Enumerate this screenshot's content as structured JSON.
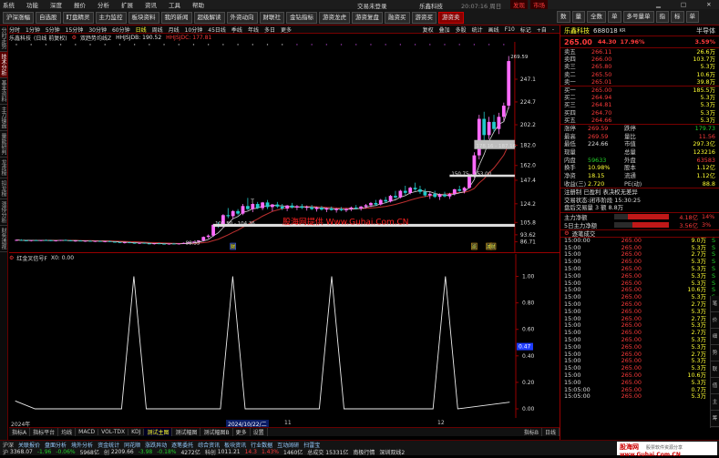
{
  "menu": [
    "系统",
    "功能",
    "深度",
    "报价",
    "分析",
    "扩展",
    "资讯",
    "工具",
    "帮助"
  ],
  "window_title": "交易未登录",
  "app_name": "乐鑫科技",
  "time": "20:07:16 周日",
  "menu_right": [
    {
      "label": "发现",
      "color": "#ff3b3b"
    },
    {
      "label": "市场",
      "color": "#ff3b3b"
    }
  ],
  "toolbar_buttons": [
    "沪深涨幅",
    "自选股",
    "盯盘精灵",
    "主力监控",
    "板块资料",
    "我的新闻",
    "超级解读",
    "外资动向",
    "财联社",
    "金钻指标",
    "游资龙虎",
    "游资复盘",
    "融资买",
    "",
    "",
    "游资买",
    "游资卖"
  ],
  "toolbar_right": [
    "数",
    "量",
    "全数",
    "单",
    "多号量单",
    "指",
    "标",
    "单"
  ],
  "left_tabs": [
    "分时走势",
    "技术分析",
    "基本资料",
    "主力操盘",
    "量能研判",
    "龙虎榜",
    "扣龙榜",
    "涨停分析",
    "财务透视"
  ],
  "period_bar": [
    "分时",
    "1分钟",
    "5分钟",
    "15分钟",
    "30分钟",
    "60分钟",
    "日线",
    "周线",
    "月线",
    "10分钟",
    "45日线",
    "季线",
    "年线",
    "多日",
    "更多"
  ],
  "period_selected": "日线",
  "period_right": [
    "复权",
    "叠加",
    "多股",
    "统计",
    "画线",
    "F10",
    "标记",
    "+自",
    "-"
  ],
  "chart_header": {
    "symbol": "乐鑫科技",
    "mode": "(日线 前复权)",
    "indicator": "双趋势均线Z",
    "ma1": "HHJSJDB: 190.52",
    "ma2": "HHJSJDC: 177.81"
  },
  "y_axis_main": [
    "247.1",
    "224.7",
    "202.2",
    "182.0",
    "162.0",
    "147.4",
    "124.2",
    "105.8",
    "93.62",
    "86.71"
  ],
  "price_annotations": [
    {
      "text": "269.59",
      "color": "#ddd"
    },
    {
      "text": "178.16 - 187.16",
      "color": "#ddd"
    },
    {
      "text": "150.75 - 153.00",
      "color": "#ddd"
    },
    {
      "text": "101.50 - 104.36",
      "color": "#ddd"
    },
    {
      "text": "88.33",
      "color": "#ddd"
    }
  ],
  "watermark": "股海网提供 Www.Guhai.Com.CN",
  "event_markers": [
    "财",
    "派",
    "减",
    "财"
  ],
  "sub_indicator": {
    "name": "红金叉信号F",
    "value": "X0: 0.00"
  },
  "y_axis_sub": [
    "1.00",
    "0.80",
    "0.60",
    "0.40",
    "0.20",
    "0.00"
  ],
  "y_axis_sub_marker": "0.47",
  "date_axis": [
    "2024年",
    "2024/10/22/二",
    "11",
    "12"
  ],
  "bottom_tabs": [
    "指标A",
    "指标平台",
    "均线",
    "MACD",
    "VOL-TDX",
    "KDJ",
    "测试主图",
    "测试幅图",
    "测试幅图B",
    "更多",
    "设置"
  ],
  "bottom_right": [
    "指标B",
    "日线"
  ],
  "stock": {
    "name": "乐鑫科技",
    "code": "688018",
    "tag": "KR",
    "extra": "半导体",
    "price": "265.00",
    "change": "44.30",
    "pct": "17.96%",
    "pct_right": "3.59%"
  },
  "asks": [
    {
      "label": "卖五",
      "price": "266.11",
      "vol": "26.6万"
    },
    {
      "label": "卖四",
      "price": "266.00",
      "vol": "103.7万"
    },
    {
      "label": "卖三",
      "price": "265.80",
      "vol": "5.3万"
    },
    {
      "label": "卖二",
      "price": "265.50",
      "vol": "10.6万"
    },
    {
      "label": "卖一",
      "price": "265.01",
      "vol": "39.8万"
    }
  ],
  "bids": [
    {
      "label": "买一",
      "price": "265.00",
      "vol": "185.5万"
    },
    {
      "label": "买二",
      "price": "264.94",
      "vol": "5.3万"
    },
    {
      "label": "买三",
      "price": "264.81",
      "vol": "5.3万"
    },
    {
      "label": "买四",
      "price": "264.70",
      "vol": "5.3万"
    },
    {
      "label": "买五",
      "price": "264.66",
      "vol": "5.3万"
    }
  ],
  "stats": [
    {
      "k": "涨停",
      "v": "269.59",
      "c": "red",
      "k2": "跌停",
      "v2": "179.73",
      "c2": "grn"
    },
    {
      "k": "最高",
      "v": "269.59",
      "c": "red",
      "k2": "量比",
      "v2": "11.56",
      "c2": "red"
    },
    {
      "k": "最低",
      "v": "224.66",
      "c": "wht",
      "k2": "市值",
      "v2": "297.3亿",
      "c2": "yel"
    },
    {
      "k": "现量",
      "v": "",
      "c": "wht",
      "k2": "总量",
      "v2": "123216",
      "c2": "yel"
    },
    {
      "k": "内盘",
      "v": "59633",
      "c": "grn",
      "k2": "外盘",
      "v2": "63583",
      "c2": "red"
    },
    {
      "k": "换手",
      "v": "10.98%",
      "c": "yel",
      "k2": "股本",
      "v2": "1.12亿",
      "c2": "yel"
    },
    {
      "k": "净资",
      "v": "18.15",
      "c": "yel",
      "k2": "流通",
      "v2": "1.12亿",
      "c2": "yel"
    },
    {
      "k": "收益(三)",
      "v": "2.720",
      "c": "yel",
      "k2": "PE(动)",
      "v2": "88.8",
      "c2": "yel"
    }
  ],
  "info_lines": [
    "注册制 已盈利 表决权无差异",
    "交易状态:闭市阶段 15:30:25",
    "盘后交易量 3 额 8.8万"
  ],
  "capital_flow": [
    {
      "label": "主力净额",
      "value": "4.18亿",
      "pct": "14%"
    },
    {
      "label": "5日主力净额",
      "value": "3.56亿",
      "pct": "3%"
    }
  ],
  "ticks_header": "逐笔成交",
  "ticks": [
    {
      "t": "15:00:00",
      "p": "265.00",
      "v": "9.0万",
      "d": "S"
    },
    {
      "t": "15:00",
      "p": "265.00",
      "v": "5.3万",
      "d": "S"
    },
    {
      "t": "15:00",
      "p": "265.00",
      "v": "2.7万",
      "d": "S"
    },
    {
      "t": "15:00",
      "p": "265.00",
      "v": "5.3万",
      "d": "S"
    },
    {
      "t": "15:00",
      "p": "265.00",
      "v": "5.3万",
      "d": "S"
    },
    {
      "t": "15:00",
      "p": "265.00",
      "v": "5.3万",
      "d": "S"
    },
    {
      "t": "15:00",
      "p": "265.00",
      "v": "5.3万",
      "d": "S"
    },
    {
      "t": "15:00",
      "p": "265.00",
      "v": "10.6万",
      "d": "S"
    },
    {
      "t": "15:00",
      "p": "265.00",
      "v": "5.3万",
      "d": "S"
    },
    {
      "t": "15:00",
      "p": "265.00",
      "v": "2.7万",
      "d": "S"
    },
    {
      "t": "15:00",
      "p": "265.00",
      "v": "5.3万",
      "d": "S"
    },
    {
      "t": "15:00",
      "p": "265.00",
      "v": "2.7万",
      "d": "S"
    },
    {
      "t": "15:00",
      "p": "265.00",
      "v": "5.3万",
      "d": "S"
    },
    {
      "t": "15:00",
      "p": "265.00",
      "v": "2.7万",
      "d": "S"
    },
    {
      "t": "15:00",
      "p": "265.00",
      "v": "5.3万",
      "d": "S"
    },
    {
      "t": "15:00",
      "p": "265.00",
      "v": "5.3万",
      "d": "S"
    },
    {
      "t": "15:00",
      "p": "265.00",
      "v": "2.7万",
      "d": "S"
    },
    {
      "t": "15:00",
      "p": "265.00",
      "v": "5.3万",
      "d": "S"
    },
    {
      "t": "15:00",
      "p": "265.00",
      "v": "5.3万",
      "d": "S"
    },
    {
      "t": "15:00",
      "p": "265.00",
      "v": "10.6万",
      "d": "S"
    },
    {
      "t": "15:00",
      "p": "265.00",
      "v": "5.3万",
      "d": "S"
    },
    {
      "t": "15:05:00",
      "p": "265.00",
      "v": "0.7万",
      "d": "B"
    },
    {
      "t": "15:05:00",
      "p": "265.00",
      "v": "5.3万",
      "d": "B"
    }
  ],
  "right_bottom_tabs": [
    "笔",
    "价",
    "细",
    "势",
    "联",
    "值",
    "主",
    "筹"
  ],
  "status_bar": [
    {
      "label": "沪",
      "value": "3368.07",
      "c": "wht"
    },
    {
      "label": "",
      "value": "-1.96",
      "c": "grn"
    },
    {
      "label": "",
      "value": "-0.06%",
      "c": "grn"
    },
    {
      "label": "",
      "value": "5968亿",
      "c": "wht"
    },
    {
      "label": "创",
      "value": "2209.66",
      "c": "wht"
    },
    {
      "label": "",
      "value": "-3.98",
      "c": "grn"
    },
    {
      "label": "",
      "value": "-0.18%",
      "c": "grn"
    },
    {
      "label": "",
      "value": "4272亿",
      "c": "wht"
    },
    {
      "label": "科创",
      "value": "1011.21",
      "c": "wht"
    },
    {
      "label": "",
      "value": "14.3",
      "c": "red"
    },
    {
      "label": "",
      "value": "1.43%",
      "c": "red"
    },
    {
      "label": "",
      "value": "1460亿",
      "c": "wht"
    },
    {
      "label": "总成交",
      "value": "15331亿",
      "c": "wht"
    },
    {
      "label": "",
      "value": "南极行情",
      "c": "wht"
    },
    {
      "label": "",
      "value": "深圳双线2",
      "c": "wht"
    }
  ],
  "status_bar2": [
    "沪深",
    "关联报价",
    "盘面分析",
    "境外分析",
    "资金统计",
    "同花顺",
    "涨跌异动",
    "逐笔委托",
    "综合资讯",
    "板块资讯",
    "行业数据",
    "互动阔研",
    "扫雷宝"
  ],
  "brand": {
    "site": "股海网",
    "slogan": "股票软件资源分享",
    "url": "www.Guhai.Com.CN"
  },
  "chart_data": {
    "type": "candlestick",
    "main_ylim": [
      80,
      275
    ],
    "sub_ylim": [
      0,
      1.1
    ],
    "candles": [
      [
        88,
        89,
        87.5,
        88.5
      ],
      [
        88.5,
        89.2,
        87.8,
        88
      ],
      [
        88,
        88.6,
        87.4,
        87.8
      ],
      [
        87.8,
        88.4,
        87,
        88.2
      ],
      [
        88.2,
        88.8,
        87.6,
        87.9
      ],
      [
        87.9,
        88.5,
        87.2,
        88.3
      ],
      [
        88.3,
        89,
        87.8,
        88.1
      ],
      [
        88.1,
        88.7,
        87.3,
        87.6
      ],
      [
        87.6,
        88.2,
        87,
        88
      ],
      [
        88,
        88.6,
        87.5,
        88.4
      ],
      [
        88.4,
        89,
        87.8,
        88
      ],
      [
        88,
        88.5,
        87.2,
        87.5
      ],
      [
        87.5,
        88,
        86.8,
        87.8
      ],
      [
        87.8,
        88.3,
        87.2,
        87.3
      ],
      [
        87.3,
        87.9,
        86.7,
        87.6
      ],
      [
        87.6,
        88.2,
        87,
        87.1
      ],
      [
        87.1,
        87.7,
        86.5,
        87.4
      ],
      [
        87.4,
        88,
        86.9,
        86.9
      ],
      [
        86.9,
        87.5,
        86.2,
        87.2
      ],
      [
        87.2,
        87.8,
        86.5,
        86.6
      ],
      [
        86.6,
        87.2,
        85.8,
        86.2
      ],
      [
        86.2,
        86.8,
        85.5,
        85.8
      ],
      [
        85.8,
        86.4,
        85,
        86.1
      ],
      [
        86.1,
        86.7,
        85.3,
        85.6
      ],
      [
        85.6,
        86.2,
        84.8,
        85.2
      ],
      [
        85.2,
        85.9,
        84.5,
        85.6
      ],
      [
        85.6,
        86.1,
        84.9,
        85
      ],
      [
        85,
        85.6,
        84.3,
        84.8
      ],
      [
        84.8,
        85.4,
        84,
        85.1
      ],
      [
        85.1,
        85.7,
        84.4,
        84.7
      ],
      [
        84.7,
        85.3,
        84,
        84.4
      ],
      [
        84.4,
        85,
        83.8,
        84.9
      ],
      [
        84.9,
        85.5,
        84.2,
        84.5
      ],
      [
        84.5,
        85.1,
        83.9,
        85
      ],
      [
        85,
        86,
        84.5,
        85.6
      ],
      [
        85.6,
        86.5,
        85,
        86
      ],
      [
        86,
        87,
        85.4,
        86.8
      ],
      [
        86.8,
        88.3,
        86,
        88
      ],
      [
        88,
        92,
        87,
        91.5
      ],
      [
        91.5,
        94,
        90,
        92.8
      ],
      [
        92.8,
        104.4,
        91.5,
        103.5
      ],
      [
        103.5,
        106,
        100.5,
        102
      ],
      [
        102,
        114,
        101,
        113
      ],
      [
        113,
        120,
        110,
        112
      ],
      [
        112,
        118,
        109,
        117
      ],
      [
        117,
        119,
        113,
        114.5
      ],
      [
        114.5,
        124,
        113,
        122
      ],
      [
        122,
        130,
        118,
        119
      ],
      [
        119,
        125,
        116,
        124
      ],
      [
        124,
        126,
        119,
        120
      ],
      [
        120,
        126,
        118,
        125.5
      ],
      [
        125.5,
        128,
        119,
        121
      ],
      [
        121,
        124,
        117,
        123.5
      ],
      [
        123.5,
        126,
        120,
        121.5
      ],
      [
        121.5,
        124,
        118,
        119.5
      ],
      [
        119.5,
        123,
        117,
        122.5
      ],
      [
        122.5,
        125,
        119.5,
        120.5
      ],
      [
        120.5,
        123,
        118,
        121.8
      ],
      [
        121.8,
        124,
        119,
        120.2
      ],
      [
        120.2,
        122.5,
        117.5,
        121
      ],
      [
        121,
        123,
        118,
        119
      ],
      [
        119,
        121.5,
        116.5,
        120.5
      ],
      [
        120.5,
        122,
        117.5,
        118.5
      ],
      [
        118.5,
        120.5,
        116,
        119.8
      ],
      [
        119.8,
        121.5,
        117.5,
        118
      ],
      [
        118,
        120,
        115.5,
        119.2
      ],
      [
        119.2,
        121,
        117,
        117.8
      ],
      [
        117.8,
        120,
        116,
        119
      ],
      [
        119,
        121.5,
        117,
        120.5
      ],
      [
        120.5,
        123,
        118.5,
        119.5
      ],
      [
        119.5,
        122,
        117.5,
        121.5
      ],
      [
        121.5,
        124,
        119.5,
        122.8
      ],
      [
        122.8,
        126,
        121,
        125
      ],
      [
        125,
        128,
        122,
        123.5
      ],
      [
        123.5,
        129,
        122.5,
        128
      ],
      [
        128,
        131,
        125,
        126.5
      ],
      [
        126.5,
        133,
        125.5,
        132
      ],
      [
        132,
        137,
        129,
        130.5
      ],
      [
        130.5,
        138,
        129.5,
        137
      ],
      [
        137,
        142,
        133,
        135
      ],
      [
        135,
        141,
        133.5,
        140
      ],
      [
        140,
        145,
        137,
        138.5
      ],
      [
        138.5,
        142,
        134,
        136
      ],
      [
        136,
        139,
        131,
        132.5
      ],
      [
        132.5,
        136,
        129,
        134
      ],
      [
        134,
        137,
        130,
        131
      ],
      [
        131,
        134.5,
        128,
        133.5
      ],
      [
        133.5,
        136,
        130.5,
        131.5
      ],
      [
        131.5,
        135,
        129,
        134
      ],
      [
        134,
        139,
        132.5,
        138.5
      ],
      [
        138.5,
        142,
        136,
        137
      ],
      [
        137,
        141,
        134.5,
        140
      ],
      [
        140,
        154,
        139,
        153
      ],
      [
        153,
        175,
        150,
        172
      ],
      [
        172,
        212,
        168,
        208
      ],
      [
        208,
        215,
        186,
        192
      ],
      [
        192,
        210,
        188,
        205
      ],
      [
        205,
        212,
        195,
        198
      ],
      [
        198,
        214,
        193,
        210
      ],
      [
        210,
        224,
        206,
        221
      ],
      [
        221,
        270,
        218,
        265
      ]
    ],
    "sub_signals": [
      {
        "index": 0,
        "value": 0.06
      },
      {
        "index": 24,
        "value": 1
      },
      {
        "index": 44,
        "value": 1
      },
      {
        "index": 64,
        "value": 1
      },
      {
        "index": 87,
        "value": 1
      },
      {
        "index": 100,
        "value": 0.05
      }
    ]
  }
}
